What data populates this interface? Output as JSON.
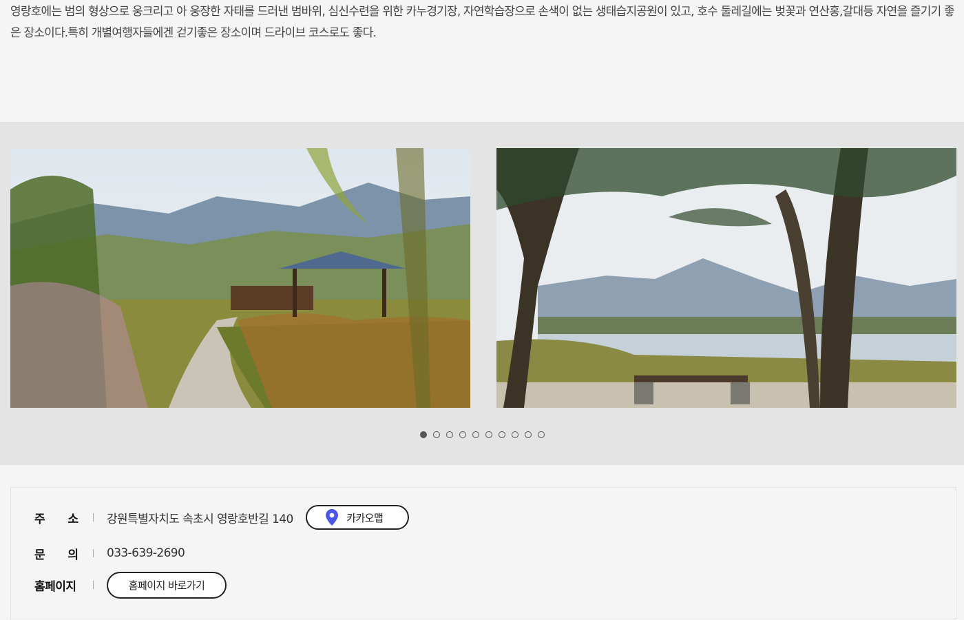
{
  "intro": {
    "text": "영랑호에는 범의 형상으로 웅크리고    아 웅장한 자태를 드러낸 범바위, 심신수련을 위한 카누경기장, 자연학습장으로 손색이 없는 생태습지공원이 있고, 호수 둘레길에는 벚꽃과 연산홍,갈대등 자연을 즐기기 좋은 장소이다.특히 개별여행자들에겐 걷기좋은 장소이며 드라이브 코스로도 좋다."
  },
  "gallery": {
    "slide_count": 10,
    "active_index": 0,
    "slides": [
      {
        "icon": "pavilion-path-photo"
      },
      {
        "icon": "lake-pine-bench-photo"
      }
    ]
  },
  "info": {
    "address": {
      "label_chars": [
        "주",
        "소"
      ],
      "value": "강원특별자치도 속초시 영랑호반길 140",
      "map_button": "카카오맵",
      "map_icon": "location-pin-icon",
      "pin_color": "#4b57e6"
    },
    "contact": {
      "label_chars": [
        "문",
        "의"
      ],
      "value": "033-639-2690"
    },
    "homepage": {
      "label": "홈페이지",
      "button": "홈페이지 바로가기"
    }
  }
}
